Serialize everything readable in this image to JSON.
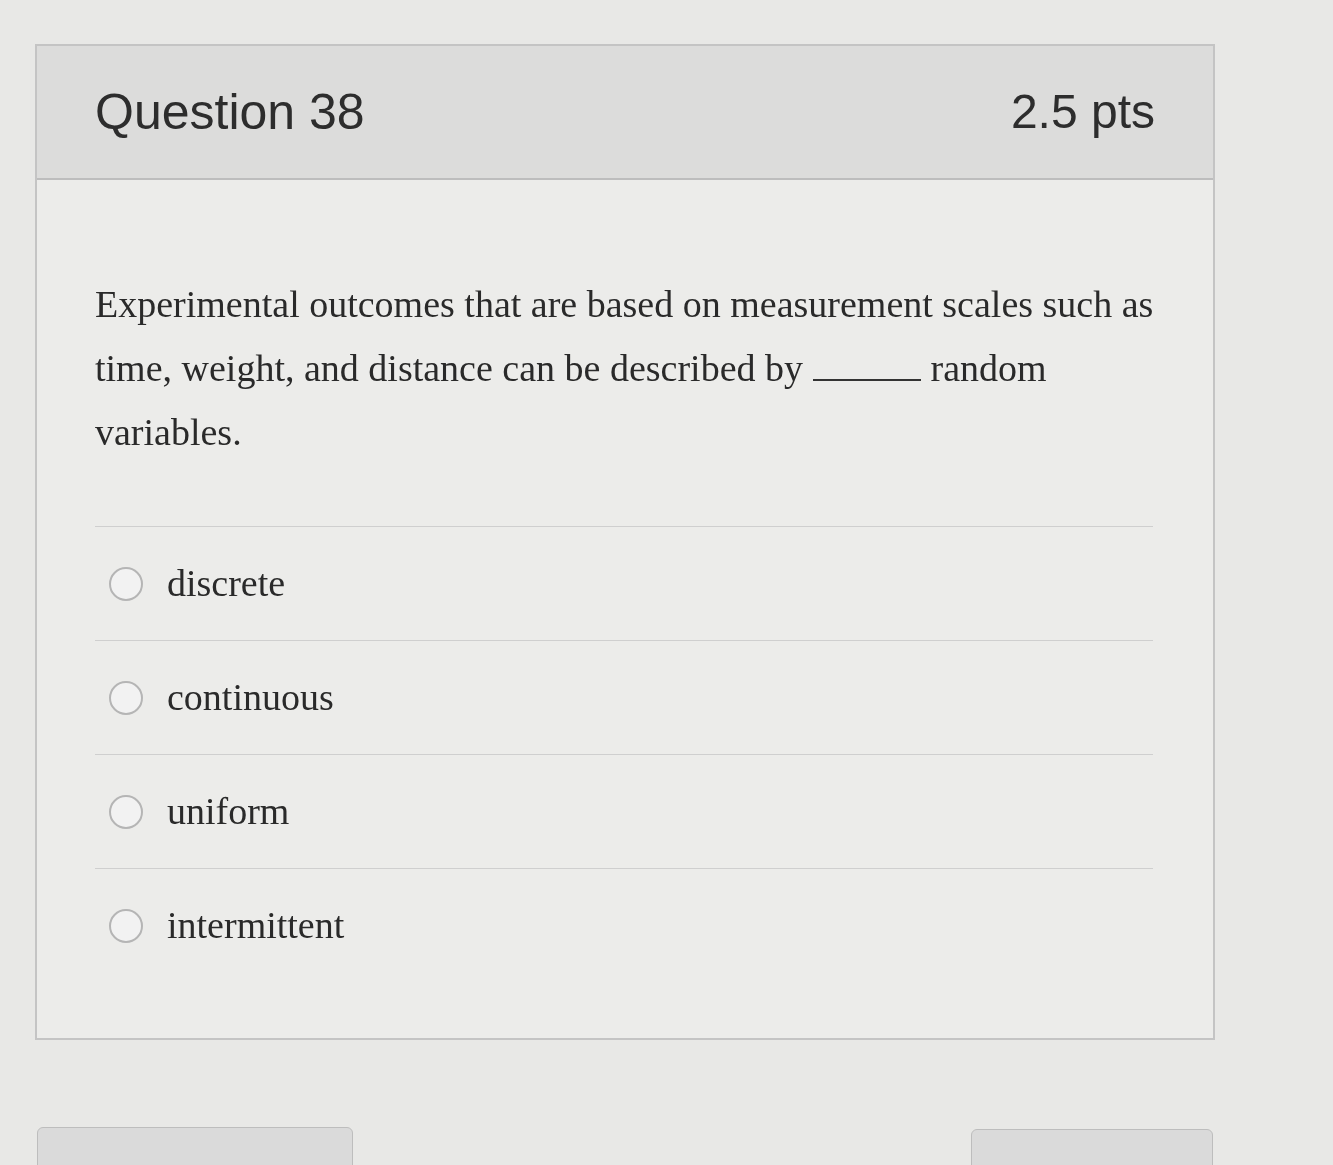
{
  "question": {
    "title": "Question 38",
    "points": "2.5 pts",
    "text_before_blank": "Experimental outcomes that are based on measurement scales such as time, weight, and distance can be described by",
    "text_after_blank": "random variables.",
    "options": [
      {
        "label": "discrete",
        "selected": false
      },
      {
        "label": "continuous",
        "selected": false
      },
      {
        "label": "uniform",
        "selected": false
      },
      {
        "label": "intermittent",
        "selected": false
      }
    ]
  }
}
